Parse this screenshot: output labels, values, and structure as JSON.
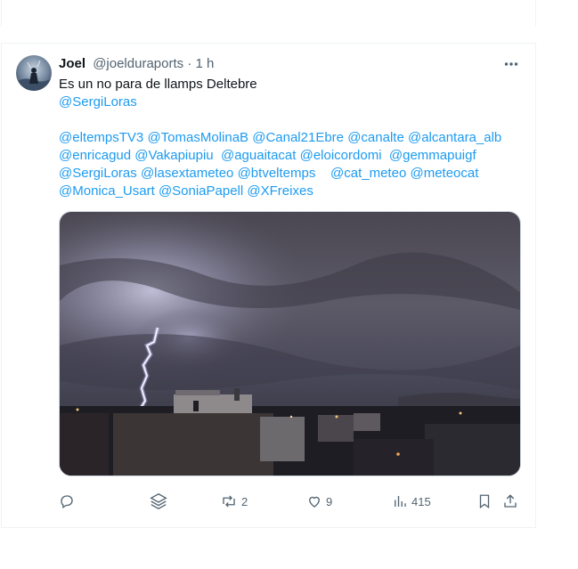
{
  "tweet": {
    "author_name": "Joel",
    "author_handle": "@joelduraports",
    "separator": "·",
    "time": "1 h",
    "lines": [
      [
        "Es un no para de llamps Deltebre"
      ],
      [
        "@SergiLoras"
      ],
      [],
      [
        "@eltempsTV3",
        "@TomasMolinaB",
        "@Canal21Ebre",
        "@canalte",
        "@alcantara_alb"
      ],
      [
        "@enricagud",
        "@Vakapiupiu",
        "@aguaitacat",
        "@eloicordomi",
        "@gemmapuigf"
      ],
      [
        "@SergiLoras",
        "@lasextameteo",
        "@btveltemps",
        "@cat_meteo",
        "@meteocat"
      ],
      [
        "@Monica_Usart",
        "@SoniaPapell",
        "@XFreixes"
      ]
    ]
  },
  "actions": {
    "reply_count": "",
    "retweet_count": "2",
    "like_count": "9",
    "views_count": "415"
  },
  "colors": {
    "accent": "#1d9bf0",
    "muted": "#536471",
    "border": "#eff3f4"
  },
  "icons": [
    "more-icon",
    "reply-icon",
    "grok-icon",
    "retweet-icon",
    "like-icon",
    "views-icon",
    "bookmark-icon",
    "share-icon"
  ]
}
